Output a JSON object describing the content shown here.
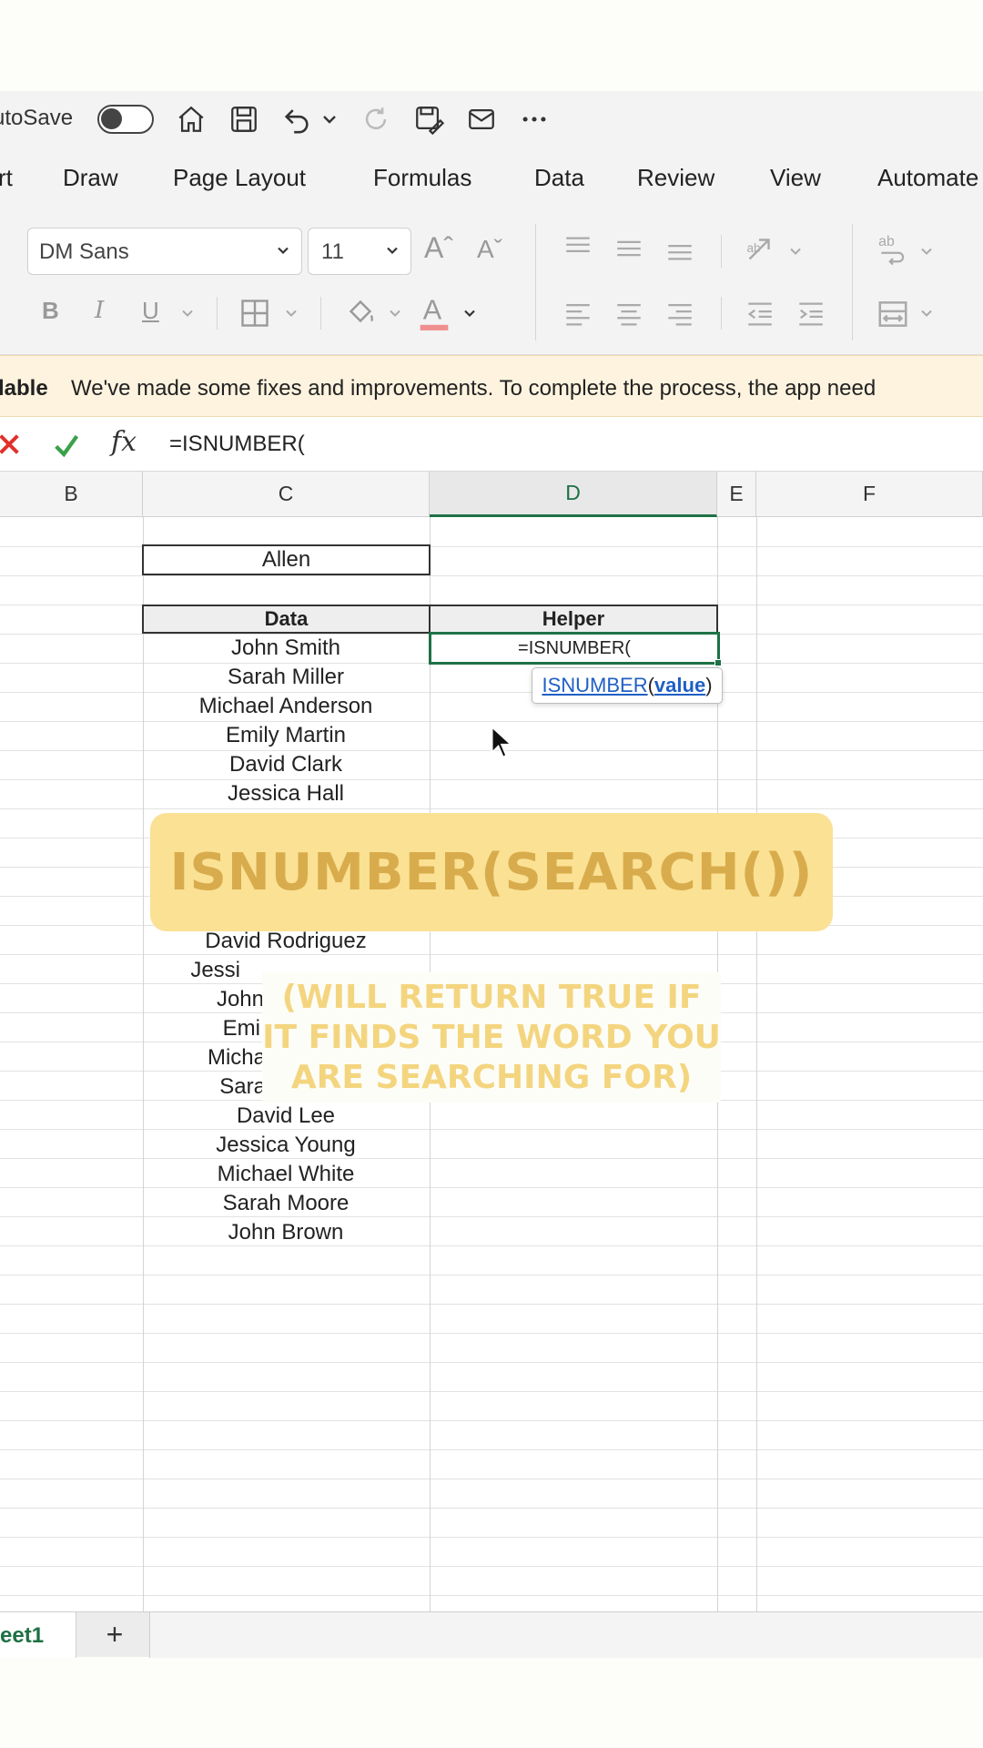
{
  "titlebar": {
    "autosave_label": "utoSave"
  },
  "tabs": [
    "rt",
    "Draw",
    "Page Layout",
    "Formulas",
    "Data",
    "Review",
    "View",
    "Automate"
  ],
  "ribbon": {
    "font_name": "DM Sans",
    "font_size": "11"
  },
  "notification": {
    "label": "lable",
    "message": "We've made some fixes and improvements. To complete the process, the app need"
  },
  "formula_bar": {
    "formula": "=ISNUMBER("
  },
  "columns": [
    "B",
    "C",
    "D",
    "E",
    "F"
  ],
  "sheet": {
    "search_value": "Allen",
    "data_header": "Data",
    "helper_header": "Helper",
    "active_cell_value": "=ISNUMBER(",
    "names": [
      "John Smith",
      "Sarah Miller",
      "Michael Anderson",
      "Emily Martin",
      "David Clark",
      "Jessica Hall",
      "David Rodriguez",
      "Jessi",
      "John",
      "Emi",
      "Micha",
      "Sara",
      "David Lee",
      "Jessica Young",
      "Michael White",
      "Sarah Moore",
      "John Brown"
    ],
    "tooltip": {
      "function": "ISNUMBER",
      "argument": "value"
    }
  },
  "overlay": {
    "banner": "ISNUMBER(SEARCH())",
    "note_line1": "(WILL RETURN TRUE IF",
    "note_line2": "IT FINDS THE WORD YOU",
    "note_line3": "ARE SEARCHING FOR)"
  },
  "sheet_tabs": {
    "active": "eet1",
    "add": "+"
  },
  "colors": {
    "accent": "#1e7145",
    "banner_bg": "#fbe194",
    "banner_text": "#d8ac4c",
    "note_text": "#f4d57f",
    "link": "#1f5fc4"
  }
}
